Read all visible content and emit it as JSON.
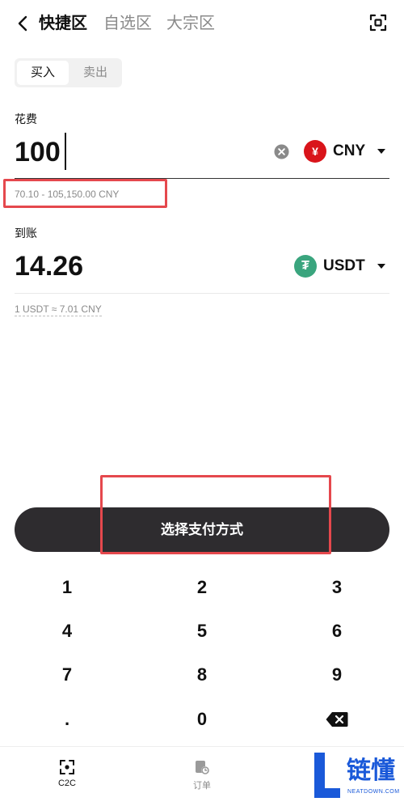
{
  "header": {
    "tabs": [
      {
        "label": "快捷区",
        "active": true
      },
      {
        "label": "自选区",
        "active": false
      },
      {
        "label": "大宗区",
        "active": false
      }
    ]
  },
  "trade_toggle": {
    "buy_label": "买入",
    "sell_label": "卖出",
    "selected": "buy"
  },
  "spend": {
    "label": "花费",
    "amount": "100",
    "currency_symbol": "¥",
    "currency_code": "CNY",
    "range": "70.10 - 105,150.00 CNY"
  },
  "receive": {
    "label": "到账",
    "amount": "14.26",
    "currency_symbol": "₮",
    "currency_code": "USDT",
    "rate": "1 USDT ≈ 7.01 CNY"
  },
  "pay_button": {
    "label": "选择支付方式"
  },
  "keypad": {
    "keys": [
      "1",
      "2",
      "3",
      "4",
      "5",
      "6",
      "7",
      "8",
      "9",
      ".",
      "0"
    ]
  },
  "bottom_nav": {
    "items": [
      {
        "label": "C2C",
        "active": true
      },
      {
        "label": "订单",
        "active": false
      }
    ]
  },
  "watermark": {
    "letter": "L",
    "name": "链懂",
    "site": "NEATDOWN.COM"
  },
  "colors": {
    "accent_dark": "#2e2c2f",
    "cny_red": "#d9141a",
    "usdt_green": "#3aa57e",
    "highlight_red": "#e5484d",
    "muted": "#8a8a8a",
    "watermark_blue": "#1a59d9"
  }
}
